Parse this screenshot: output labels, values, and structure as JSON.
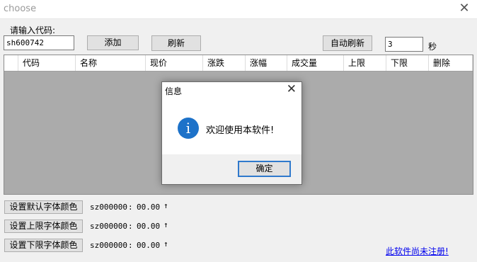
{
  "window": {
    "title": "choose",
    "close_glyph": "✕"
  },
  "input_area": {
    "code_label": "请输入代码:",
    "code_value": "sh600742",
    "add_label": "添加",
    "refresh_label": "刷新",
    "auto_refresh_label": "自动刷新",
    "interval_value": "3",
    "seconds_label": "秒"
  },
  "table": {
    "columns": [
      "代码",
      "名称",
      "现价",
      "涨跌",
      "涨幅",
      "成交量",
      "上限",
      "下限",
      "删除"
    ]
  },
  "color_settings": [
    {
      "button": "设置默认字体颜色",
      "code": "sz000000",
      "sep": ":",
      "value": "00.00",
      "arrow": "↑"
    },
    {
      "button": "设置上限字体颜色",
      "code": "sz000000",
      "sep": ":",
      "value": "00.00",
      "arrow": "↑"
    },
    {
      "button": "设置下限字体颜色",
      "code": "sz000000",
      "sep": ":",
      "value": "00.00",
      "arrow": "↑"
    }
  ],
  "register_link": "此软件尚未注册!",
  "dialog": {
    "title": "信息",
    "close_glyph": "✕",
    "icon": "info-icon",
    "icon_glyph": "i",
    "message": "欢迎使用本软件!",
    "ok_label": "确定"
  },
  "colors": {
    "grid_bg": "#ababab",
    "info_icon": "#1d72c9",
    "link": "#0000ee"
  }
}
